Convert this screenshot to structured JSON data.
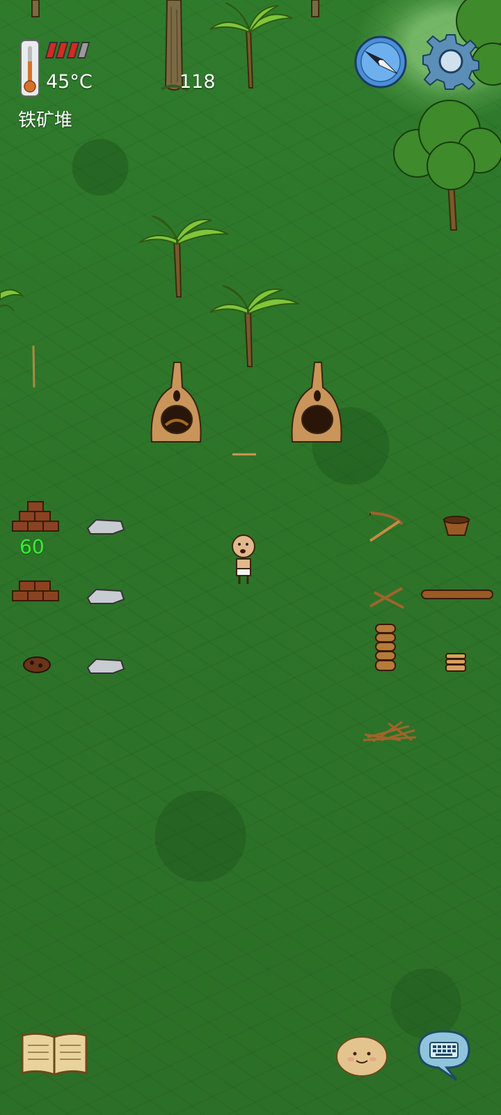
{
  "hud": {
    "temperature": "45°C",
    "location_name": "铁矿堆",
    "counter": "118",
    "health_cells": {
      "filled": 3,
      "total": 4
    },
    "compass_heading_deg": 305
  },
  "world": {
    "stack_count_label": "60",
    "objects": [
      "palm-tree",
      "palm-tree",
      "palm-tree",
      "tree-trunk",
      "broadleaf-tree",
      "clay-kiln",
      "clay-kiln",
      "brick-stack",
      "brick-stack",
      "iron-ore-pile",
      "flint-stone",
      "flint-stone",
      "flint-stone",
      "bow-drill",
      "crossed-sticks",
      "long-log",
      "woven-basket",
      "clay-bowl-stack",
      "clay-plate-stack",
      "kindling-pile",
      "stick",
      "player-character"
    ]
  },
  "colors": {
    "grass": "#2f7a2c",
    "count_label": "#35ef35",
    "health_full": "#d42a22",
    "health_empty": "#9a9a9a"
  },
  "icons": {
    "thermometer": "thermometer-icon",
    "compass": "compass-icon",
    "settings": "gear-icon",
    "journal": "book-icon",
    "emote": "face-icon",
    "chat": "keyboard-chat-icon"
  }
}
